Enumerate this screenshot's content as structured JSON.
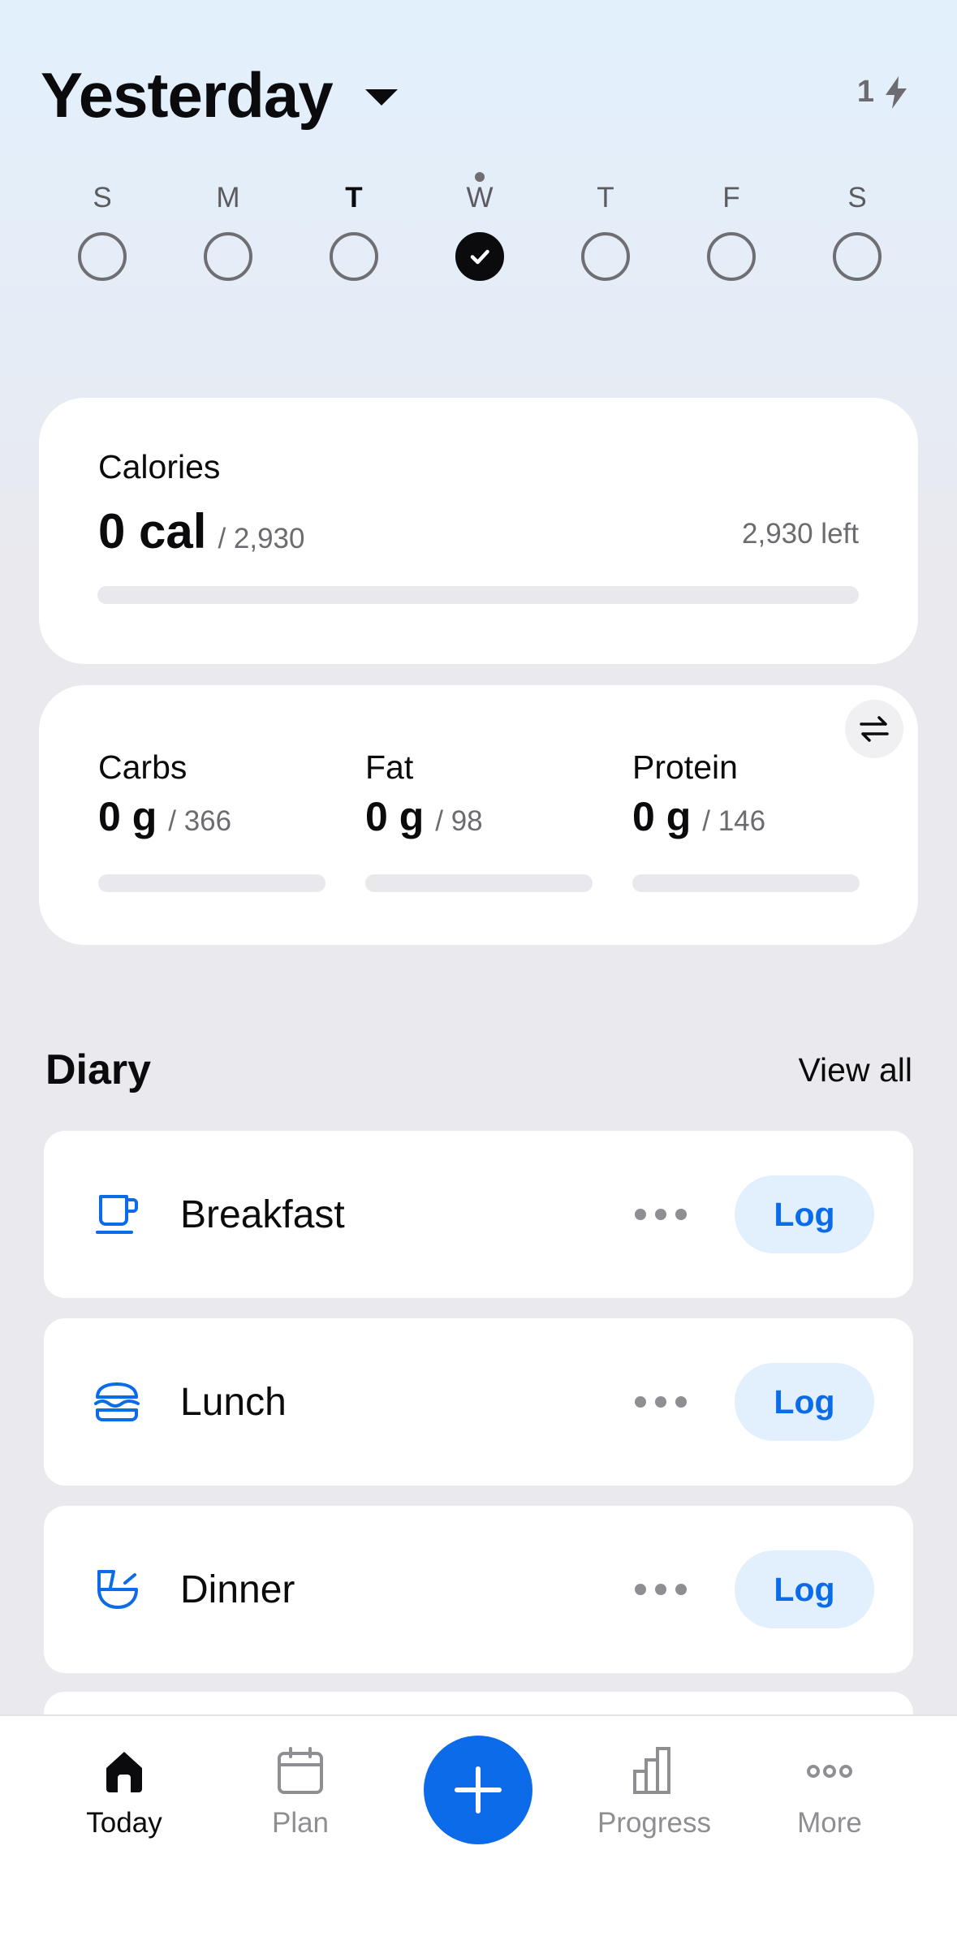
{
  "header": {
    "title": "Yesterday",
    "streak_count": "1"
  },
  "week": [
    {
      "letter": "S",
      "bold": false,
      "checked": false,
      "dot": false
    },
    {
      "letter": "M",
      "bold": false,
      "checked": false,
      "dot": false
    },
    {
      "letter": "T",
      "bold": true,
      "checked": false,
      "dot": false
    },
    {
      "letter": "W",
      "bold": false,
      "checked": true,
      "dot": true
    },
    {
      "letter": "T",
      "bold": false,
      "checked": false,
      "dot": false
    },
    {
      "letter": "F",
      "bold": false,
      "checked": false,
      "dot": false
    },
    {
      "letter": "S",
      "bold": false,
      "checked": false,
      "dot": false
    }
  ],
  "calories": {
    "label": "Calories",
    "value": "0 cal",
    "goal": "/ 2,930",
    "left": "2,930 left",
    "progress": 0
  },
  "macros": [
    {
      "name": "Carbs",
      "value": "0 g",
      "goal": "/ 366",
      "progress": 0
    },
    {
      "name": "Fat",
      "value": "0 g",
      "goal": "/ 98",
      "progress": 0
    },
    {
      "name": "Protein",
      "value": "0 g",
      "goal": "/ 146",
      "progress": 0
    }
  ],
  "diary": {
    "title": "Diary",
    "view_all": "View all",
    "meals": [
      {
        "name": "Breakfast",
        "icon": "coffee-cup-icon",
        "log_label": "Log"
      },
      {
        "name": "Lunch",
        "icon": "burger-icon",
        "log_label": "Log"
      },
      {
        "name": "Dinner",
        "icon": "bowl-icon",
        "log_label": "Log"
      }
    ]
  },
  "tabs": {
    "today": "Today",
    "plan": "Plan",
    "progress": "Progress",
    "more": "More"
  },
  "colors": {
    "accent": "#0b6be8",
    "log_bg": "#e2effc",
    "muted": "#8e8e93"
  }
}
